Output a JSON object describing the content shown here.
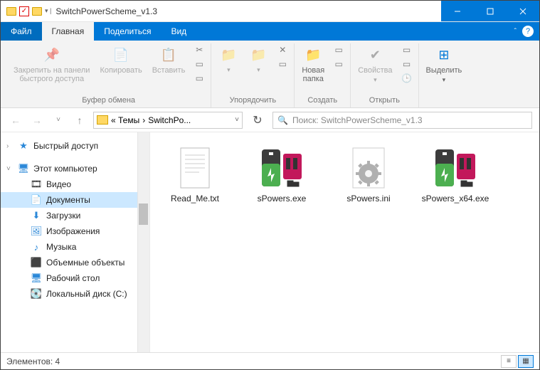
{
  "window": {
    "title": "SwitchPowerScheme_v1.3"
  },
  "menu": {
    "file": "Файл",
    "home": "Главная",
    "share": "Поделиться",
    "view": "Вид"
  },
  "ribbon": {
    "pin": "Закрепить на панели\nбыстрого доступа",
    "copy": "Копировать",
    "paste": "Вставить",
    "group_clipboard": "Буфер обмена",
    "group_organize": "Упорядочить",
    "new_folder": "Новая\nпапка",
    "group_create": "Создать",
    "properties": "Свойства",
    "group_open": "Открыть",
    "select": "Выделить",
    "group_select": ""
  },
  "breadcrumb": {
    "part1": "« Темы",
    "sep": "›",
    "part2": "SwitchPo..."
  },
  "search": {
    "placeholder": "Поиск: SwitchPowerScheme_v1.3"
  },
  "nav": {
    "quick": "Быстрый доступ",
    "pc": "Этот компьютер",
    "videos": "Видео",
    "documents": "Документы",
    "downloads": "Загрузки",
    "pictures": "Изображения",
    "music": "Музыка",
    "objects3d": "Объемные объекты",
    "desktop": "Рабочий стол",
    "diskc": "Локальный диск (C:)"
  },
  "files": [
    {
      "name": "Read_Me.txt",
      "type": "txt"
    },
    {
      "name": "sPowers.exe",
      "type": "exe"
    },
    {
      "name": "sPowers.ini",
      "type": "ini"
    },
    {
      "name": "sPowers_x64.exe",
      "type": "exe"
    }
  ],
  "status": {
    "count_label": "Элементов: 4"
  }
}
